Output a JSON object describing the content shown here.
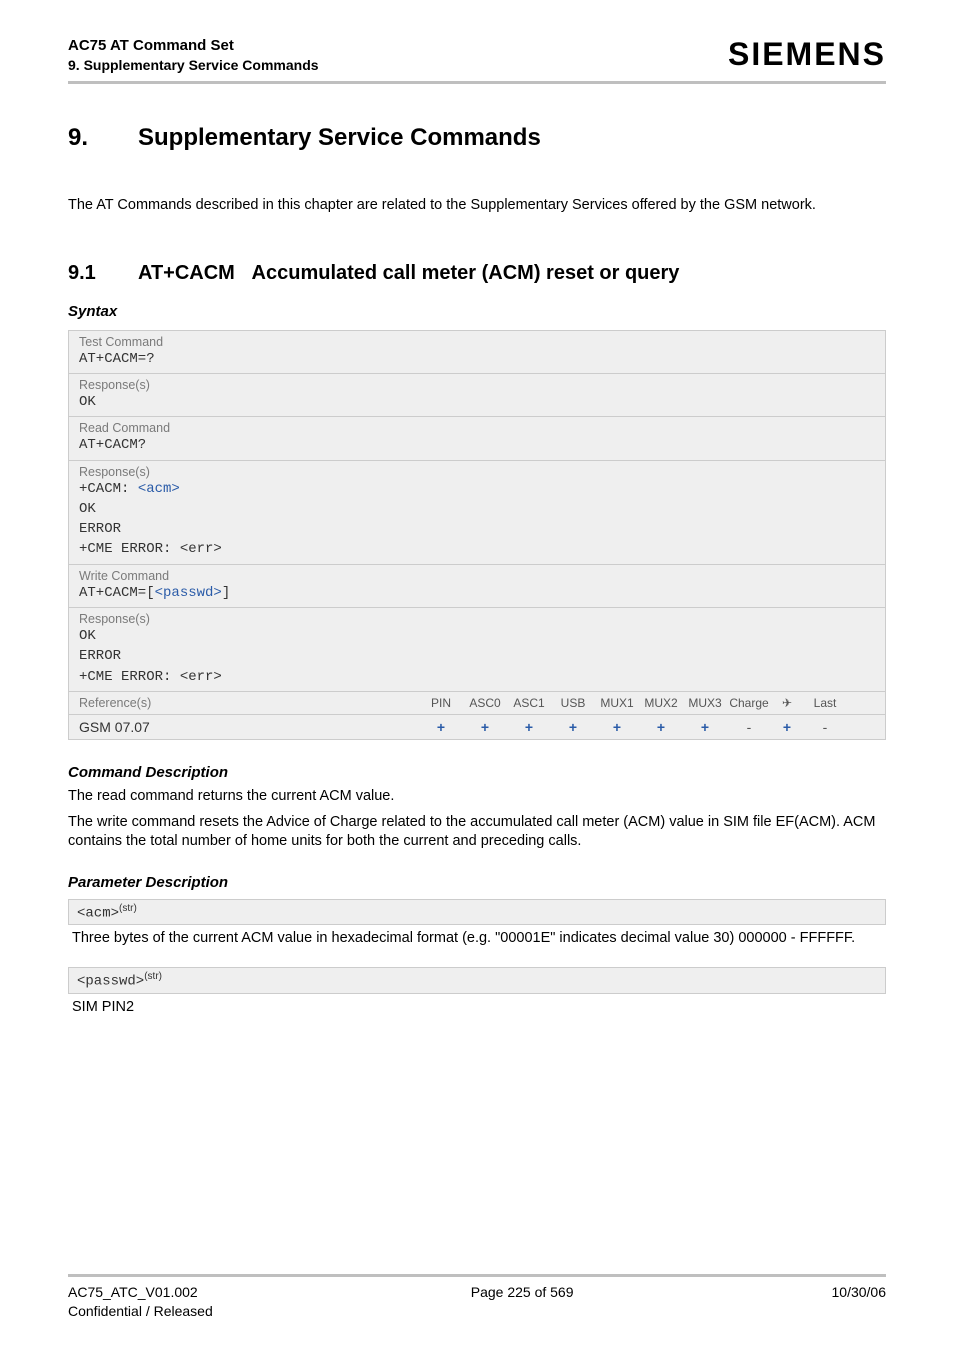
{
  "header": {
    "title": "AC75 AT Command Set",
    "subtitle": "9. Supplementary Service Commands",
    "brand": "SIEMENS"
  },
  "chapter": {
    "number": "9.",
    "title": "Supplementary Service Commands",
    "intro": "The AT Commands described in this chapter are related to the Supplementary Services offered by the GSM network."
  },
  "section": {
    "number": "9.1",
    "cmd": "AT+CACM",
    "title": "Accumulated call meter (ACM) reset or query"
  },
  "syntax": {
    "label": "Syntax",
    "test_label": "Test Command",
    "test_code": "AT+CACM=?",
    "test_resp_label": "Response(s)",
    "test_resp": "OK",
    "read_label": "Read Command",
    "read_code": "AT+CACM?",
    "read_resp_label": "Response(s)",
    "read_resp_prefix": "+CACM: ",
    "read_resp_link": "<acm>",
    "read_resp_rest": "OK\nERROR\n+CME ERROR: <err>",
    "write_label": "Write Command",
    "write_code_prefix": "AT+CACM=[",
    "write_code_link": "<passwd>",
    "write_code_suffix": "]",
    "write_resp_label": "Response(s)",
    "write_resp": "OK\nERROR\n+CME ERROR: <err>",
    "ref_label": "Reference(s)",
    "ref_cols": [
      "PIN",
      "ASC0",
      "ASC1",
      "USB",
      "MUX1",
      "MUX2",
      "MUX3",
      "Charge",
      "✈",
      "Last"
    ],
    "gsm_label": "GSM 07.07",
    "gsm_vals": [
      "+",
      "+",
      "+",
      "+",
      "+",
      "+",
      "+",
      "-",
      "+",
      "-"
    ]
  },
  "cmd_desc": {
    "label": "Command Description",
    "p1": "The read command returns the current ACM value.",
    "p2": "The write command resets the Advice of Charge related to the accumulated call meter (ACM) value in SIM file EF(ACM). ACM contains the total number of home units for both the current and preceding calls."
  },
  "param_desc": {
    "label": "Parameter Description",
    "p1_name": "<acm>",
    "p1_type": "(str)",
    "p1_text": "Three bytes of the current ACM value in hexadecimal format (e.g. \"00001E\" indicates decimal value 30) 000000 - FFFFFF.",
    "p2_name": "<passwd>",
    "p2_type": "(str)",
    "p2_text": "SIM PIN2"
  },
  "footer": {
    "left1": "AC75_ATC_V01.002",
    "left2": "Confidential / Released",
    "center": "Page 225 of 569",
    "right": "10/30/06"
  }
}
